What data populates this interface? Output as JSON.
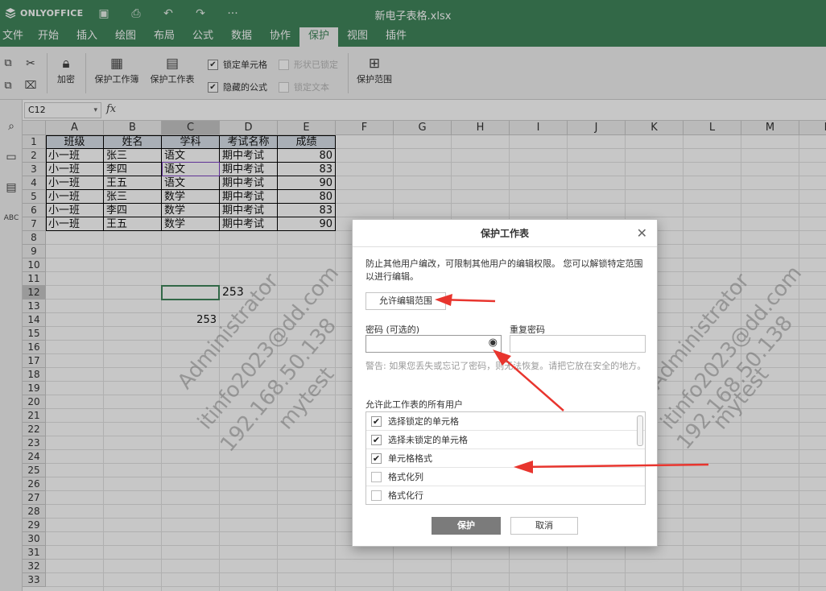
{
  "app": {
    "logo": "ONLYOFFICE",
    "doc_title": "新电子表格.xlsx"
  },
  "menu": {
    "tabs": [
      "文件",
      "开始",
      "插入",
      "绘图",
      "布局",
      "公式",
      "数据",
      "协作",
      "保护",
      "视图",
      "插件"
    ],
    "active": "保护"
  },
  "toolbar": {
    "encrypt": "加密",
    "protect_workbook": "保护工作簿",
    "protect_sheet": "保护工作表",
    "locked_cell": "锁定单元格",
    "hidden_formula": "隐藏的公式",
    "shape_locked": "形状已锁定",
    "lock_text": "锁定文本",
    "protect_range": "保护范围"
  },
  "formula_bar": {
    "cell_ref": "C12",
    "fx": "fx"
  },
  "sheet": {
    "columns": [
      "A",
      "B",
      "C",
      "D",
      "E",
      "F",
      "G",
      "H",
      "I",
      "J",
      "K",
      "L",
      "M",
      "N"
    ],
    "rows": [
      "1",
      "2",
      "3",
      "4",
      "5",
      "6",
      "7",
      "8",
      "9",
      "10",
      "11",
      "12",
      "13",
      "14",
      "15",
      "16",
      "17",
      "18",
      "19",
      "20",
      "21",
      "22",
      "23",
      "24",
      "25",
      "26",
      "27",
      "28",
      "29",
      "30",
      "31",
      "32",
      "33"
    ],
    "header": [
      "班级",
      "姓名",
      "学科",
      "考试名称",
      "成绩"
    ],
    "data": [
      [
        "小一班",
        "张三",
        "语文",
        "期中考试",
        "80"
      ],
      [
        "小一班",
        "李四",
        "语文",
        "期中考试",
        "83"
      ],
      [
        "小一班",
        "王五",
        "语文",
        "期中考试",
        "90"
      ],
      [
        "小一班",
        "张三",
        "数学",
        "期中考试",
        "80"
      ],
      [
        "小一班",
        "李四",
        "数学",
        "期中考试",
        "83"
      ],
      [
        "小一班",
        "王五",
        "数学",
        "期中考试",
        "90"
      ]
    ],
    "d12": "253",
    "c14": "253"
  },
  "watermark": [
    "Administrator",
    "itinfo2023@dd.com",
    "192.168.50.138",
    "mytest"
  ],
  "dialog": {
    "title": "保护工作表",
    "description": "防止其他用户编改，可限制其他用户的编辑权限。 您可以解锁特定范围以进行编辑。",
    "allow_ranges_button": "允许编辑范围",
    "password_label": "密码 (可选的)",
    "repeat_label": "重复密码",
    "warning": "警告: 如果您丢失或忘记了密码，则无法恢复。请把它放在安全的地方。",
    "allow_label": "允许此工作表的所有用户",
    "options": [
      {
        "label": "选择锁定的单元格",
        "checked": true
      },
      {
        "label": "选择未锁定的单元格",
        "checked": true
      },
      {
        "label": "单元格格式",
        "checked": true
      },
      {
        "label": "格式化列",
        "checked": false
      },
      {
        "label": "格式化行",
        "checked": false
      }
    ],
    "protect_button": "保护",
    "cancel_button": "取消"
  },
  "colors": {
    "brand": "#40865c",
    "annotation": "#e8352e"
  }
}
